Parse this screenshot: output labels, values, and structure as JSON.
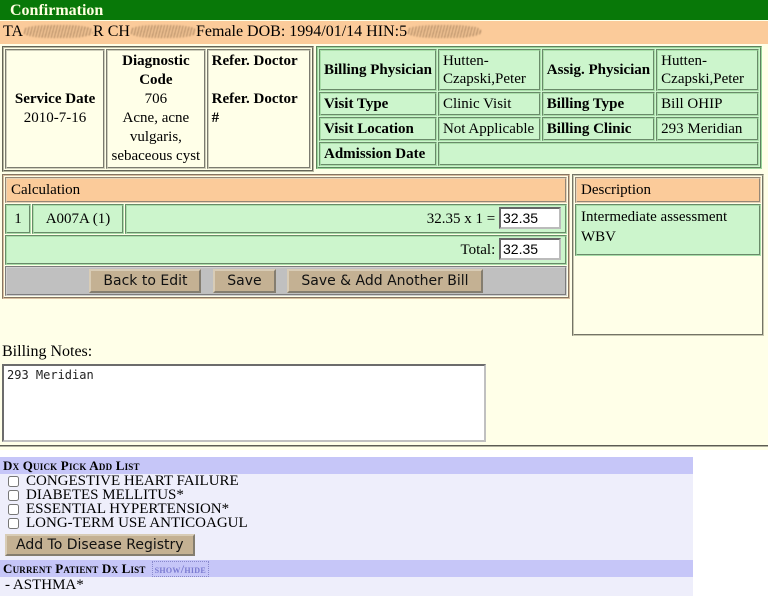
{
  "colors": {
    "title_bar_green": "#087808",
    "demographic_peach": "#fbcb9a",
    "table_green": "#ccf5cc",
    "page_ivory": "#ffffe8",
    "dx_header_lavender": "#c6c6f8",
    "dx_body_lavender": "#eeeefb",
    "button_tan": "#c4b193"
  },
  "title_bar": {
    "label": "Confirmation"
  },
  "demographic": {
    "name_prefix": "TA",
    "name_mid": "R CH",
    "sex": "Female",
    "dob_label": "DOB:",
    "dob_value": "1994/01/14",
    "hin_label": "HIN:",
    "hin_prefix": "5",
    "redacted": true
  },
  "service_info": {
    "service_date_label": "Service Date",
    "service_date_value": "2010-7-16",
    "diagnostic_code_label": "Diagnostic Code",
    "diagnostic_code_value": "706",
    "diagnostic_code_desc": "Acne, acne vulgaris, sebaceous cyst",
    "refer_doctor_label": "Refer. Doctor",
    "refer_doctor_value": "",
    "refer_doctor_num_label": "Refer. Doctor #",
    "refer_doctor_num_value": ""
  },
  "billing_info": {
    "billing_physician_label": "Billing Physician",
    "billing_physician_value": "Hutten-Czapski,Peter",
    "assig_physician_label": "Assig. Physician",
    "assig_physician_value": "Hutten-Czapski,Peter",
    "visit_type_label": "Visit Type",
    "visit_type_value": "Clinic Visit",
    "billing_type_label": "Billing Type",
    "billing_type_value": "Bill OHIP",
    "visit_location_label": "Visit Location",
    "visit_location_value": "Not Applicable",
    "billing_clinic_label": "Billing Clinic",
    "billing_clinic_value": "293 Meridian",
    "admission_date_label": "Admission Date",
    "admission_date_value": ""
  },
  "calculation": {
    "header": "Calculation",
    "description_header": "Description",
    "row": {
      "index": "1",
      "code": "A007A (1)",
      "expression": "32.35 x 1 =",
      "amount": "32.35",
      "description": "Intermediate assessment WBV"
    },
    "total_label": "Total:",
    "total_value": "32.35",
    "buttons": {
      "back_to_edit": "Back to Edit",
      "save": "Save",
      "save_add_another": "Save & Add Another Bill"
    }
  },
  "billing_notes": {
    "label": "Billing Notes:",
    "value": "293 Meridian",
    "placeholder": ""
  },
  "dx_quick_pick": {
    "header": "Dx Quick Pick Add List",
    "items": [
      {
        "label": "CONGESTIVE HEART FAILURE",
        "checked": false
      },
      {
        "label": "DIABETES MELLITUS*",
        "checked": false
      },
      {
        "label": "ESSENTIAL HYPERTENSION*",
        "checked": false
      },
      {
        "label": "LONG-TERM USE ANTICOAGUL",
        "checked": false
      }
    ],
    "add_button": "Add To Disease Registry"
  },
  "dx_current": {
    "header": "Current Patient Dx List",
    "show_hide": "show/hide",
    "items": [
      "- ASTHMA*"
    ]
  }
}
